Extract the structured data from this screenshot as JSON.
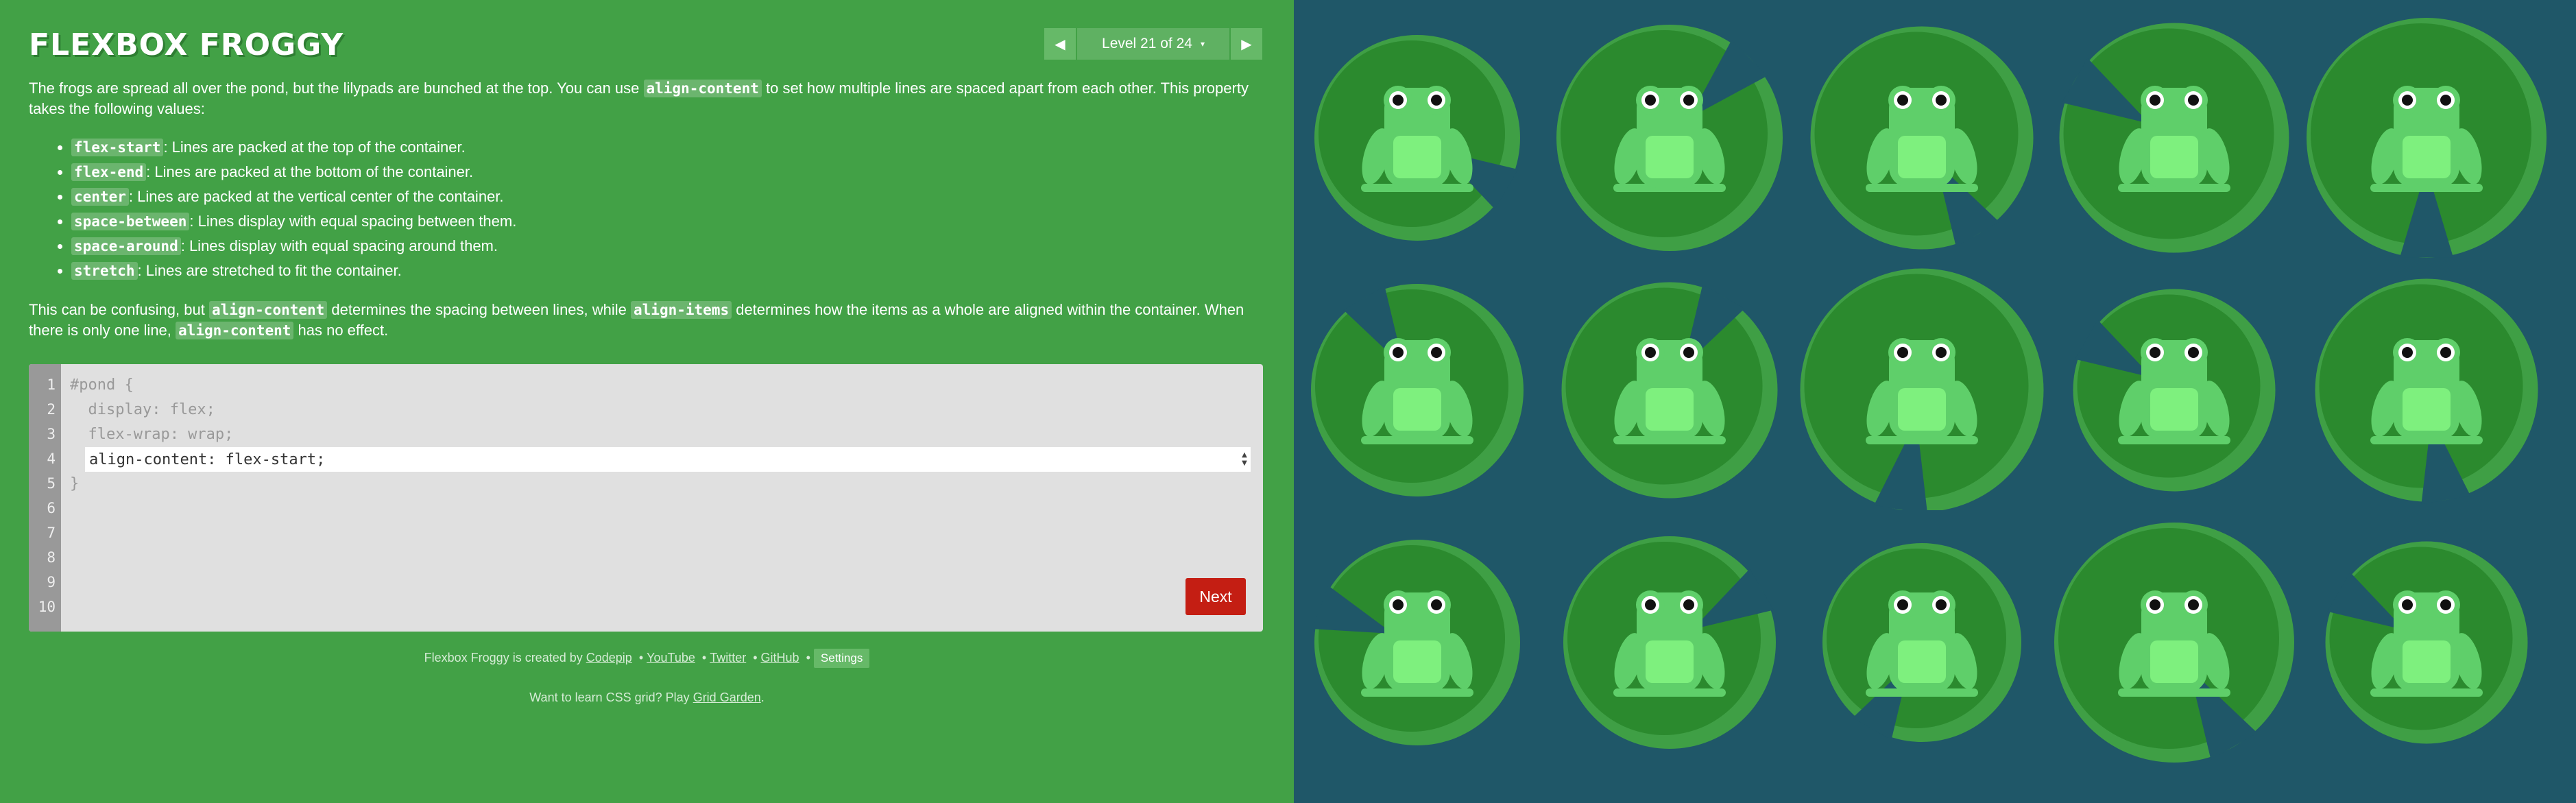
{
  "app": {
    "title": "FLEXBOX FROGGY"
  },
  "level_nav": {
    "prev_icon": "triangle-left-icon",
    "next_icon": "triangle-right-icon",
    "label": "Level 21 of 24",
    "caret": "▾"
  },
  "instructions": {
    "intro_before": "The frogs are spread all over the pond, but the lilypads are bunched at the top. You can use ",
    "intro_code": "align-content",
    "intro_after": " to set how multiple lines are spaced apart from each other. This property takes the following values:",
    "values": [
      {
        "code": "flex-start",
        "desc": ": Lines are packed at the top of the container."
      },
      {
        "code": "flex-end",
        "desc": ": Lines are packed at the bottom of the container."
      },
      {
        "code": "center",
        "desc": ": Lines are packed at the vertical center of the container."
      },
      {
        "code": "space-between",
        "desc": ": Lines display with equal spacing between them."
      },
      {
        "code": "space-around",
        "desc": ": Lines display with equal spacing around them."
      },
      {
        "code": "stretch",
        "desc": ": Lines are stretched to fit the container."
      }
    ],
    "note_a": "This can be confusing, but ",
    "note_code1": "align-content",
    "note_b": " determines the spacing between lines, while ",
    "note_code2": "align-items",
    "note_c": " determines how the items as a whole are aligned within the container. When there is only one line, ",
    "note_code3": "align-content",
    "note_d": " has no effect."
  },
  "editor": {
    "line_numbers": [
      "1",
      "2",
      "3",
      "4",
      "5",
      "6",
      "7",
      "8",
      "9",
      "10"
    ],
    "line1": "#pond {",
    "line2": "  display: flex;",
    "line3": "  flex-wrap: wrap;",
    "input_value": "align-content: flex-start;",
    "line5": "}",
    "next_label": "Next"
  },
  "footer": {
    "credit_prefix": "Flexbox Froggy is created by ",
    "links": [
      "Codepip",
      "YouTube",
      "Twitter",
      "GitHub"
    ],
    "separator": "•",
    "settings_label": "Settings",
    "grid_prefix": "Want to learn CSS grid? Play ",
    "grid_link": "Grid Garden",
    "grid_suffix": "."
  },
  "board": {
    "colors": {
      "water": "#1f5768",
      "lilypad_dark": "#2b8a2e",
      "lilypad_light": "#3f9f45",
      "frog_body": "#5fcf6a",
      "frog_belly": "#7ef07e",
      "frog_dark": "#238b2b"
    },
    "frog_icon": "green-frog-icon",
    "lilypad_icon": "lilypad-icon",
    "frog_count": 15
  }
}
